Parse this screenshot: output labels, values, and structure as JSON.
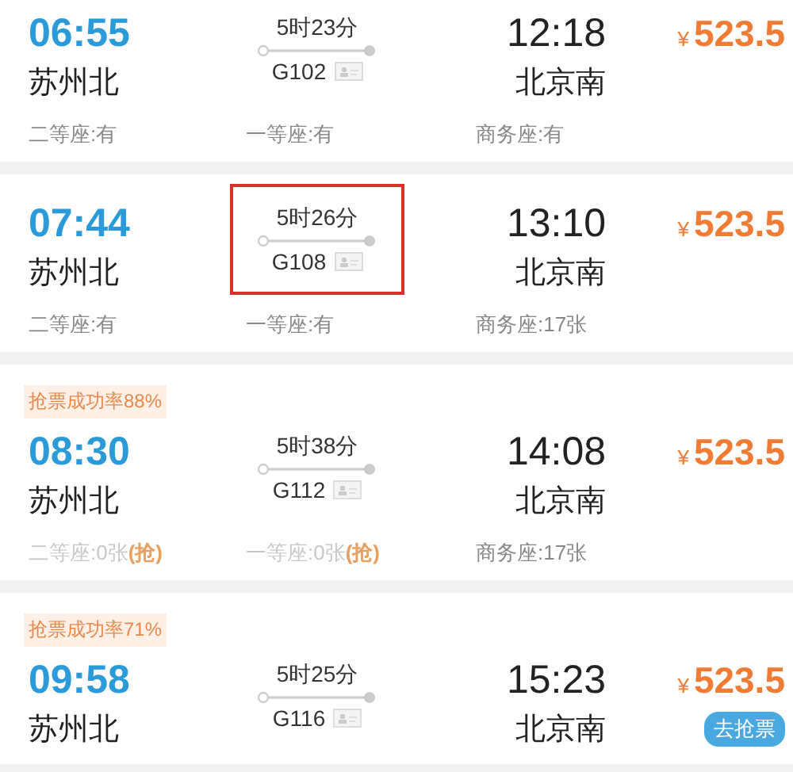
{
  "trains": [
    {
      "depart": "06:55",
      "from": "苏州北",
      "duration": "5时23分",
      "train_no": "G102",
      "arrive": "12:18",
      "to": "北京南",
      "currency": "¥",
      "price": "523.5",
      "highlighted": false,
      "seats": [
        {
          "label": "二等座:有",
          "available": true
        },
        {
          "label": "一等座:有",
          "available": true
        },
        {
          "label": "商务座:有",
          "available": true
        }
      ]
    },
    {
      "depart": "07:44",
      "from": "苏州北",
      "duration": "5时26分",
      "train_no": "G108",
      "arrive": "13:10",
      "to": "北京南",
      "currency": "¥",
      "price": "523.5",
      "highlighted": true,
      "seats": [
        {
          "label": "二等座:有",
          "available": true
        },
        {
          "label": "一等座:有",
          "available": true
        },
        {
          "label": "商务座:17张",
          "available": true
        }
      ]
    },
    {
      "badge": "抢票成功率88%",
      "depart": "08:30",
      "from": "苏州北",
      "duration": "5时38分",
      "train_no": "G112",
      "arrive": "14:08",
      "to": "北京南",
      "currency": "¥",
      "price": "523.5",
      "highlighted": false,
      "seats": [
        {
          "label": "二等座:0张",
          "available": false,
          "grab": "(抢)"
        },
        {
          "label": "一等座:0张",
          "available": false,
          "grab": "(抢)"
        },
        {
          "label": "商务座:17张",
          "available": true
        }
      ]
    },
    {
      "badge": "抢票成功率71%",
      "depart": "09:58",
      "from": "苏州北",
      "duration": "5时25分",
      "train_no": "G116",
      "arrive": "15:23",
      "to": "北京南",
      "currency": "¥",
      "price": "523.5",
      "highlighted": false,
      "action": "去抢票"
    }
  ]
}
